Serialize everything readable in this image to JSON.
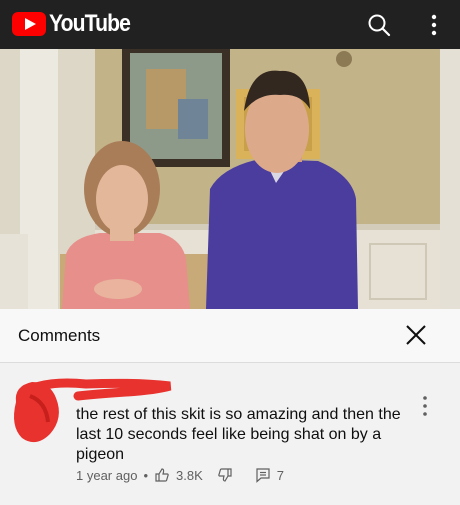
{
  "app": {
    "logo_text": "YouTube"
  },
  "comments": {
    "title": "Comments"
  },
  "comment": {
    "text": "the rest of this skit is so amazing and then the last 10 seconds feel like being shat on by a pigeon",
    "time": "1 year ago",
    "separator": "•",
    "likes": "3.8K",
    "replies": "7"
  },
  "colors": {
    "brand_red": "#ff0000",
    "top_bar": "#212121",
    "redaction": "#e8322e"
  },
  "icons": [
    "youtube-play-icon",
    "search-icon",
    "more-vert-icon",
    "close-icon",
    "thumbs-up-icon",
    "thumbs-down-icon",
    "reply-icon"
  ]
}
